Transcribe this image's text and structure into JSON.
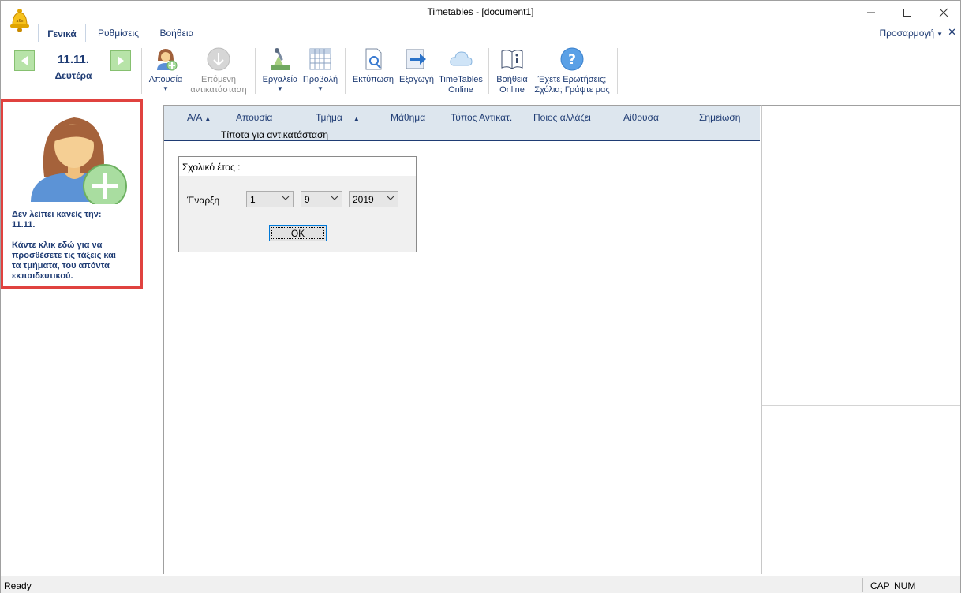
{
  "window": {
    "title": "Timetables - [document1]"
  },
  "tabs": [
    {
      "label": "Γενικά",
      "active": true
    },
    {
      "label": "Ρυθμίσεις",
      "active": false
    },
    {
      "label": "Βοήθεια",
      "active": false
    }
  ],
  "customize_label": "Προσαρμογή",
  "ribbon": {
    "date": "11.11.",
    "day": "Δευτέρα",
    "absence": "Απουσία",
    "next_sub_1": "Επόμενη",
    "next_sub_2": "αντικατάσταση",
    "tools": "Εργαλεία",
    "view": "Προβολή",
    "print": "Εκτύπωση",
    "export": "Εξαγωγή",
    "online_1": "TimeTables",
    "online_2": "Online",
    "help_1": "Βοήθεια",
    "help_2": "Online",
    "questions_1": "Έχετε Ερωτήσεις;",
    "questions_2": "Σχόλια; Γράψτε μας"
  },
  "left_panel": {
    "line1": "Δεν λείπει κανείς την:",
    "line2": "11.11.",
    "line3": "Κάντε κλικ εδώ για να",
    "line4": "προσθέσετε τις τάξεις και",
    "line5": "τα τμήματα, του απόντα",
    "line6": "εκπαιδευτικού."
  },
  "grid": {
    "columns": [
      "Α/Α",
      "Απουσία",
      "Τμήμα",
      "Μάθημα",
      "Τύπος Αντικατ.",
      "Ποιος αλλάζει",
      "Αίθουσα",
      "Σημείωση"
    ],
    "empty_message": "Τίποτα για αντικατάσταση"
  },
  "dialog": {
    "title": "Σχολικό έτος :",
    "start_label": "Έναρξη",
    "day": "1",
    "month": "9",
    "year": "2019",
    "ok": "OK"
  },
  "status": {
    "text": "Ready",
    "cap": "CAP",
    "num": "NUM"
  },
  "colors": {
    "accent": "#1f3c74",
    "highlight_border": "#e0423f",
    "header_bg": "#dde6ee"
  }
}
